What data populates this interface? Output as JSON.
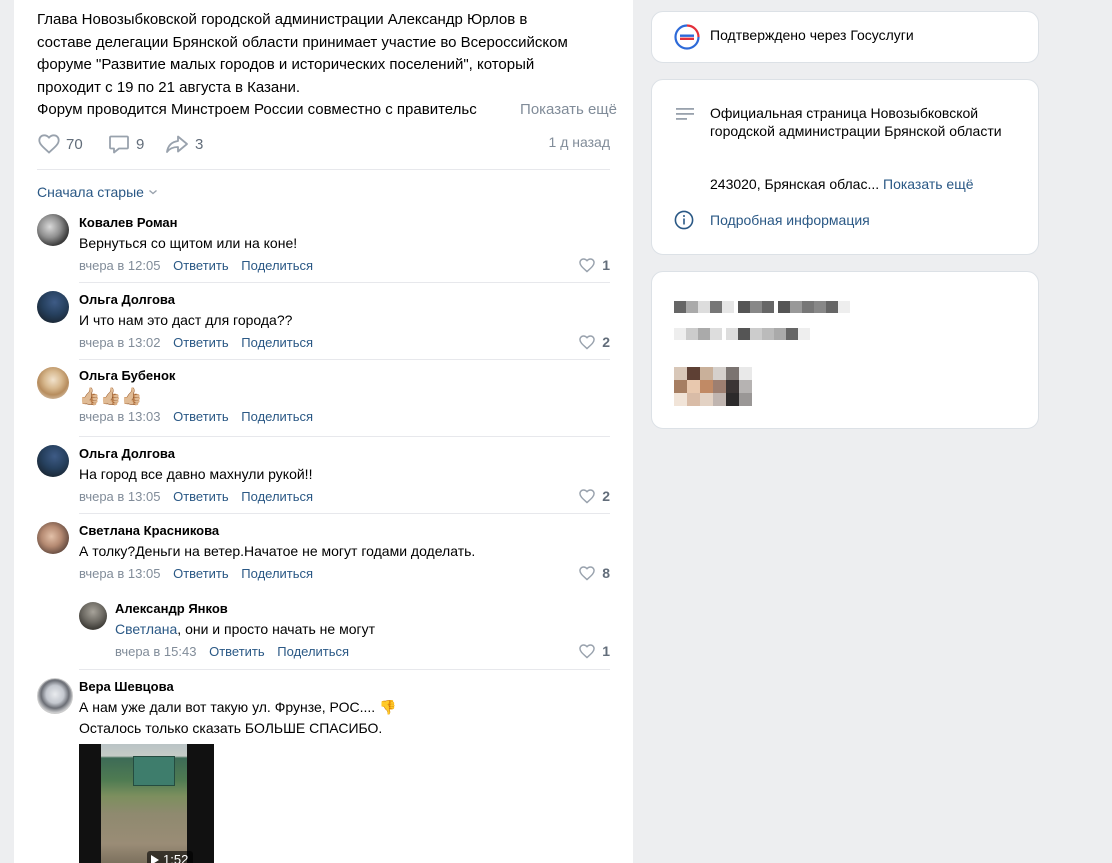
{
  "post": {
    "text_lines": [
      "Глава Новозыбковской городской администрации Александр Юрлов в",
      "составе делегации Брянской области принимает участие во Всероссийском",
      "форуме \"Развитие малых городов и исторических поселений\", который",
      "проходит с 19 по 21 августа в Казани."
    ],
    "clipped_line": "Форум проводится Минстроем России совместно с правительс",
    "show_more": "Показать ещё",
    "likes": "70",
    "comments": "9",
    "shares": "3",
    "time_ago": "1 д назад",
    "sort_label": "Сначала старые"
  },
  "comments": [
    {
      "name": "Ковалев Роман",
      "text": "Вернуться со щитом или на коне!",
      "time": "вчера в 12:05",
      "reply": "Ответить",
      "share": "Поделиться",
      "likes": "1"
    },
    {
      "name": "Ольга Долгова",
      "text": "И что нам это даст для города??",
      "time": "вчера в 13:02",
      "reply": "Ответить",
      "share": "Поделиться",
      "likes": "2"
    },
    {
      "name": "Ольга Бубенок",
      "text": "👍🏼👍🏼👍🏼",
      "time": "вчера в 13:03",
      "reply": "Ответить",
      "share": "Поделиться",
      "likes": ""
    },
    {
      "name": "Ольга Долгова",
      "text": "На город все давно махнули рукой!!",
      "time": "вчера в 13:05",
      "reply": "Ответить",
      "share": "Поделиться",
      "likes": "2"
    },
    {
      "name": "Светлана Красникова",
      "text": "А толку?Деньги на ветер.Начатое не могут годами доделать.",
      "time": "вчера в 13:05",
      "reply": "Ответить",
      "share": "Поделиться",
      "likes": "8"
    }
  ],
  "reply_comment": {
    "name": "Александр Янков",
    "mention": "Светлана",
    "text": ", они и просто начать не могут",
    "time": "вчера в 15:43",
    "reply": "Ответить",
    "share": "Поделиться",
    "likes": "1"
  },
  "last_comment": {
    "name": "Вера Шевцова",
    "line1": "А нам уже дали вот такую ул. Фрунзе, РОС.... 👎",
    "line2": "Осталось только сказать БОЛЬШЕ СПАСИБО.",
    "video_duration": "1:52"
  },
  "sidebar": {
    "verified": "Подтверждено через Госуслуги",
    "page_title": "Официальная страница Новозыбковской городской администрации Брянской области",
    "address": "243020, Брянская облас...",
    "address_more": "Показать ещё",
    "details": "Подробная информация"
  },
  "colors": {
    "link": "#2a5885",
    "muted": "#818c99",
    "background": "#edeef0"
  }
}
